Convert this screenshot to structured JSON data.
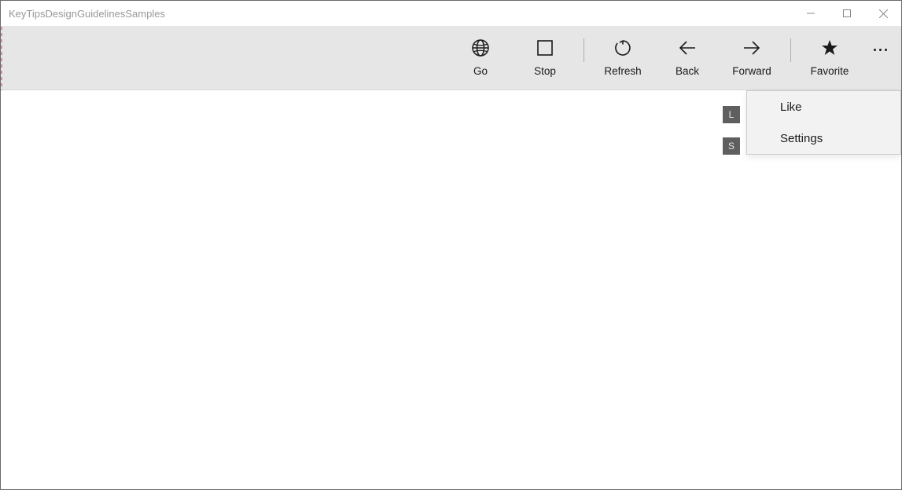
{
  "window": {
    "title": "KeyTipsDesignGuidelinesSamples"
  },
  "commandbar": {
    "go": "Go",
    "stop": "Stop",
    "refresh": "Refresh",
    "back": "Back",
    "forward": "Forward",
    "favorite": "Favorite"
  },
  "menu": {
    "like": "Like",
    "settings": "Settings"
  },
  "keytips": {
    "like": "L",
    "settings": "S"
  }
}
